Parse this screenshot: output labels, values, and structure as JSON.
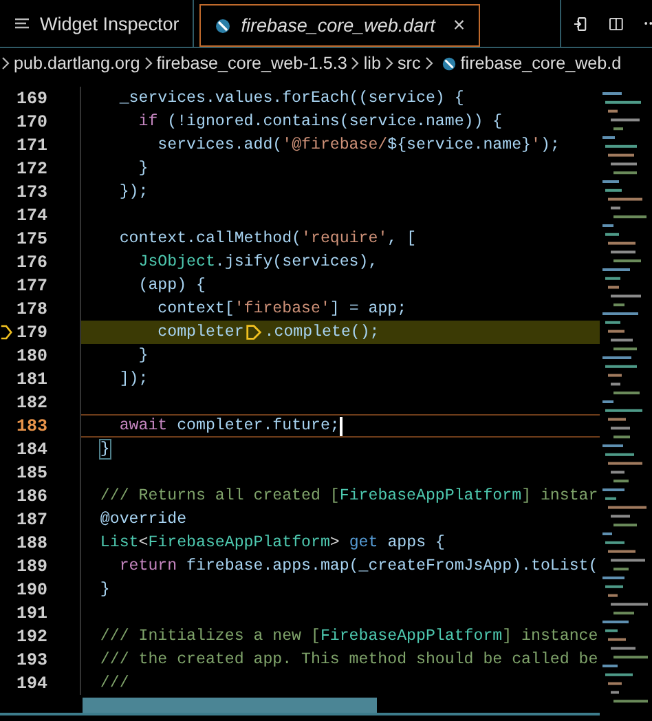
{
  "tabs": [
    {
      "label": "Widget Inspector",
      "kind": "panel",
      "selected": false,
      "preview": false
    },
    {
      "label": "firebase_core_web.dart",
      "kind": "dart",
      "selected": true,
      "preview": true,
      "close": "×"
    }
  ],
  "breadcrumb": [
    {
      "label": "pub.dartlang.org",
      "kind": "folder"
    },
    {
      "label": "firebase_core_web-1.5.3",
      "kind": "folder"
    },
    {
      "label": "lib",
      "kind": "folder"
    },
    {
      "label": "src",
      "kind": "folder"
    },
    {
      "label": "firebase_core_web.d",
      "kind": "dart"
    }
  ],
  "lines": [
    {
      "number": "169",
      "kind": "normal",
      "tokens": [
        {
          "t": "    _services.values.forEach((service) {",
          "kind": "plain"
        }
      ]
    },
    {
      "number": "170",
      "kind": "normal",
      "tokens": [
        {
          "t": "      if",
          "kind": "kw"
        },
        {
          "t": " (!ignored.contains(service.name)) {",
          "kind": "plain"
        }
      ]
    },
    {
      "number": "171",
      "kind": "normal",
      "tokens": [
        {
          "t": "        services.add(",
          "kind": "plain"
        },
        {
          "t": "'@firebase/",
          "kind": "str"
        },
        {
          "t": "${service.name}",
          "kind": "plain"
        },
        {
          "t": "'",
          "kind": "str"
        },
        {
          "t": ");",
          "kind": "plain"
        }
      ]
    },
    {
      "number": "172",
      "kind": "normal",
      "tokens": [
        {
          "t": "      }",
          "kind": "plain"
        }
      ]
    },
    {
      "number": "173",
      "kind": "normal",
      "tokens": [
        {
          "t": "    });",
          "kind": "plain"
        }
      ]
    },
    {
      "number": "174",
      "kind": "normal"
    },
    {
      "number": "175",
      "kind": "normal",
      "tokens": [
        {
          "t": "    context.callMethod(",
          "kind": "plain"
        },
        {
          "t": "'require'",
          "kind": "str"
        },
        {
          "t": ", [",
          "kind": "plain"
        }
      ]
    },
    {
      "number": "176",
      "kind": "normal",
      "tokens": [
        {
          "t": "      JsObject",
          "kind": "type"
        },
        {
          "t": ".jsify(services),",
          "kind": "plain"
        }
      ]
    },
    {
      "number": "177",
      "kind": "normal",
      "tokens": [
        {
          "t": "      (app) {",
          "kind": "plain"
        }
      ]
    },
    {
      "number": "178",
      "kind": "normal",
      "tokens": [
        {
          "t": "        context[",
          "kind": "plain"
        },
        {
          "t": "'firebase'",
          "kind": "str"
        },
        {
          "t": "] = app;",
          "kind": "plain"
        }
      ]
    },
    {
      "number": "179",
      "kind": "paused",
      "tokens": [
        {
          "t": "        completer",
          "kind": "plain"
        },
        {
          "kind": "breakpoint"
        },
        {
          "t": ".complete();",
          "kind": "plain"
        }
      ]
    },
    {
      "number": "180",
      "kind": "normal",
      "tokens": [
        {
          "t": "      }",
          "kind": "plain"
        }
      ]
    },
    {
      "number": "181",
      "kind": "normal",
      "tokens": [
        {
          "t": "    ]);",
          "kind": "plain"
        }
      ]
    },
    {
      "number": "182",
      "kind": "normal"
    },
    {
      "number": "183",
      "kind": "cursor",
      "tokens": [
        {
          "t": "    await",
          "kind": "kw"
        },
        {
          "t": " completer.future;",
          "kind": "plain"
        }
      ]
    },
    {
      "number": "184",
      "kind": "normal",
      "tokens": [
        {
          "t": "  }",
          "kind": "match"
        }
      ]
    },
    {
      "number": "185",
      "kind": "normal"
    },
    {
      "number": "186",
      "kind": "normal",
      "tokens": [
        {
          "t": "  /// Returns all created [",
          "kind": "comment"
        },
        {
          "t": "FirebaseAppPlatform",
          "kind": "type"
        },
        {
          "t": "] instar",
          "kind": "comment"
        }
      ]
    },
    {
      "number": "187",
      "kind": "normal",
      "tokens": [
        {
          "t": "  @override",
          "kind": "plain"
        }
      ]
    },
    {
      "number": "188",
      "kind": "normal",
      "tokens": [
        {
          "t": "  List",
          "kind": "type"
        },
        {
          "t": "<",
          "kind": "punct"
        },
        {
          "t": "FirebaseAppPlatform",
          "kind": "type"
        },
        {
          "t": ">",
          "kind": "punct"
        },
        {
          "t": " get",
          "kind": "decl"
        },
        {
          "t": " apps {",
          "kind": "plain"
        }
      ]
    },
    {
      "number": "189",
      "kind": "normal",
      "tokens": [
        {
          "t": "    return",
          "kind": "kw"
        },
        {
          "t": " firebase.apps.map(_createFromJsApp).toList(",
          "kind": "plain"
        }
      ]
    },
    {
      "number": "190",
      "kind": "normal",
      "tokens": [
        {
          "t": "  }",
          "kind": "plain"
        }
      ]
    },
    {
      "number": "191",
      "kind": "normal"
    },
    {
      "number": "192",
      "kind": "normal",
      "tokens": [
        {
          "t": "  /// Initializes a new [",
          "kind": "comment"
        },
        {
          "t": "FirebaseAppPlatform",
          "kind": "type"
        },
        {
          "t": "] instance",
          "kind": "comment"
        }
      ]
    },
    {
      "number": "193",
      "kind": "normal",
      "tokens": [
        {
          "t": "  /// the created app. This method should be called be",
          "kind": "comment"
        }
      ]
    },
    {
      "number": "194",
      "kind": "normal",
      "tokens": [
        {
          "t": "  ///",
          "kind": "comment"
        }
      ]
    }
  ]
}
